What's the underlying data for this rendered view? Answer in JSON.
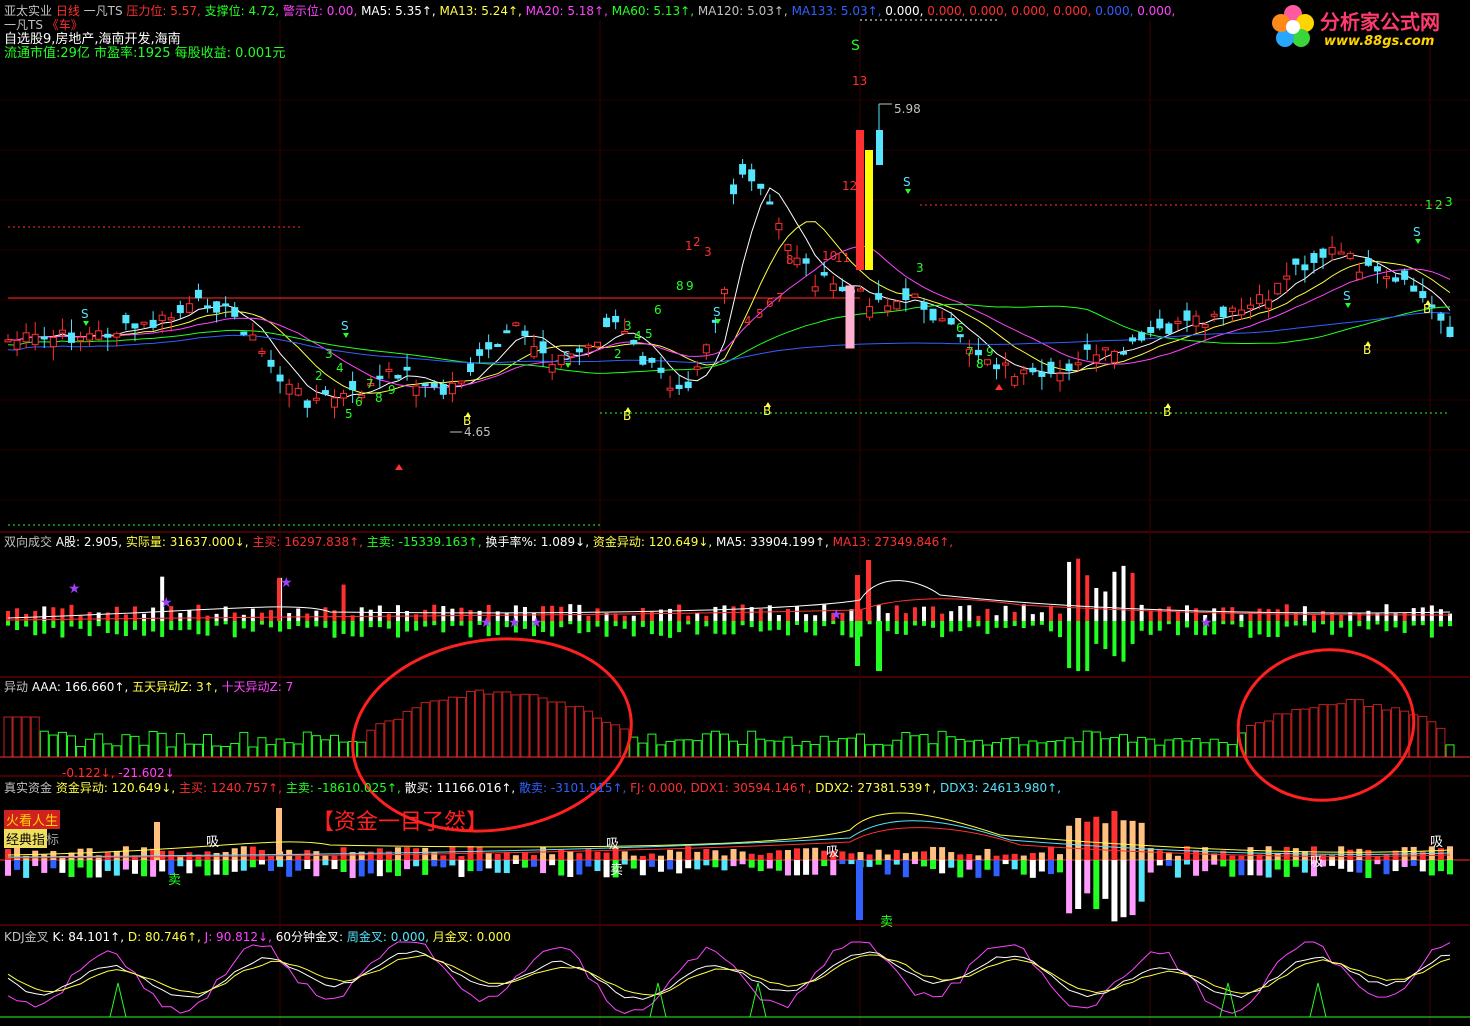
{
  "colors": {
    "red": "#ff3030",
    "green": "#22ff22",
    "cyan": "#55e5ff",
    "yellow": "#ffff44",
    "magenta": "#ff44ff",
    "white": "#ffffff",
    "blue": "#3060ff",
    "gray": "#c0c0c0",
    "pink": "#ff9aff"
  },
  "logo": {
    "title": "分析家公式网",
    "url": "www.88gs.com",
    "icon": "flower-logo-icon"
  },
  "main": {
    "header": [
      {
        "t": "亚太实业 ",
        "c": "gray"
      },
      {
        "t": "日线",
        "c": "red"
      },
      {
        "t": "  一凡TS  ",
        "c": "gray"
      },
      {
        "t": "压力位: 5.57,",
        "c": "red"
      },
      {
        "t": " 支撑位: 4.72,",
        "c": "green"
      },
      {
        "t": " 警示位: 0.00,",
        "c": "magenta"
      },
      {
        "t": " MA5: 5.35↑,",
        "c": "white"
      },
      {
        "t": " MA13: 5.24↑,",
        "c": "yellow"
      },
      {
        "t": " MA20: 5.18↑,",
        "c": "magenta"
      },
      {
        "t": " MA60: 5.13↑,",
        "c": "green"
      },
      {
        "t": " MA120: 5.03↑,",
        "c": "gray"
      },
      {
        "t": " MA133: 5.03↑,",
        "c": "blue"
      },
      {
        "t": " 0.000,",
        "c": "white"
      },
      {
        "t": " 0.000,",
        "c": "red"
      },
      {
        "t": " 0.000,",
        "c": "red"
      },
      {
        "t": " 0.000,",
        "c": "red"
      },
      {
        "t": " 0.000,",
        "c": "red"
      },
      {
        "t": " 0.000,",
        "c": "blue"
      },
      {
        "t": " 0.000,",
        "c": "magenta"
      }
    ],
    "line2": [
      {
        "t": "一凡TS",
        "c": "gray"
      },
      {
        "t": "   《车》",
        "c": "red"
      }
    ],
    "line3": [
      {
        "t": "自选股9,房地产,海南开发,海南",
        "c": "white"
      }
    ],
    "line4": [
      {
        "t": "流通市值:29亿   市盈率:1925   每股收益: 0.001元",
        "c": "green"
      }
    ],
    "high_label": "5.98",
    "low_label": "4.65",
    "signals": {
      "S": "S",
      "B": "B"
    },
    "count_labels": [
      "13",
      "12",
      "1",
      "2",
      "3",
      "8",
      "10",
      "11",
      "4",
      "5",
      "6",
      "7",
      "8",
      "9",
      "3",
      "4",
      "5",
      "6",
      "2",
      "3",
      "4",
      "5",
      "6",
      "7",
      "8",
      "9",
      "6",
      "7",
      "8",
      "9",
      "1",
      "2",
      "3",
      "3",
      "2"
    ]
  },
  "vol": {
    "header": [
      {
        "t": "双向成交  ",
        "c": "gray"
      },
      {
        "t": "A股: 2.905,",
        "c": "white"
      },
      {
        "t": " 实际量: 31637.000↓,",
        "c": "yellow"
      },
      {
        "t": " 主买: 16297.838↑,",
        "c": "red"
      },
      {
        "t": " 主卖: -15339.163↑,",
        "c": "green"
      },
      {
        "t": " 换手率%: 1.089↓,",
        "c": "white"
      },
      {
        "t": " 资金异动: 120.649↓,",
        "c": "yellow"
      },
      {
        "t": " MA5: 33904.199↑,",
        "c": "white"
      },
      {
        "t": " MA13: 27349.846↑,",
        "c": "red"
      }
    ]
  },
  "aaa": {
    "header": [
      {
        "t": "异动  ",
        "c": "gray"
      },
      {
        "t": "AAA: 166.660↑,",
        "c": "white"
      },
      {
        "t": " 五天异动Z: 3↑,",
        "c": "yellow"
      },
      {
        "t": " 十天异动Z: 7",
        "c": "magenta"
      }
    ]
  },
  "fund": {
    "values_line": [
      {
        "t": "-0.122↓,",
        "c": "red"
      },
      {
        "t": " -21.602↓",
        "c": "magenta"
      }
    ],
    "header": [
      {
        "t": "真实资金  ",
        "c": "gray"
      },
      {
        "t": "资金异动: 120.649↓,",
        "c": "yellow"
      },
      {
        "t": " 主买: 1240.757↑,",
        "c": "red"
      },
      {
        "t": " 主卖: -18610.025↑,",
        "c": "green"
      },
      {
        "t": " 散买: 11166.016↑,",
        "c": "white"
      },
      {
        "t": " 散卖: -3101.915↑,",
        "c": "blue"
      },
      {
        "t": " FJ: 0.000,",
        "c": "red"
      },
      {
        "t": " DDX1: 30594.146↑,",
        "c": "red"
      },
      {
        "t": " DDX2: 27381.539↑,",
        "c": "yellow"
      },
      {
        "t": " DDX3: 24613.980↑,",
        "c": "cyan"
      }
    ],
    "tag1": "火看人生",
    "tag2": "经典指",
    "tag3": "标",
    "annotation": "【资金一目了然】",
    "markers": {
      "xi": "吸",
      "mai": "卖"
    }
  },
  "kdj": {
    "header": [
      {
        "t": "KDJ金叉  ",
        "c": "gray"
      },
      {
        "t": "K: 84.101↑,",
        "c": "white"
      },
      {
        "t": " D: 80.746↑,",
        "c": "yellow"
      },
      {
        "t": " J: 90.812↓,",
        "c": "magenta"
      },
      {
        "t": " 60分钟金叉:",
        "c": "white"
      },
      {
        "t": " 周金叉: 0.000,",
        "c": "cyan"
      },
      {
        "t": " 月金叉: 0.000",
        "c": "yellow"
      }
    ]
  }
}
